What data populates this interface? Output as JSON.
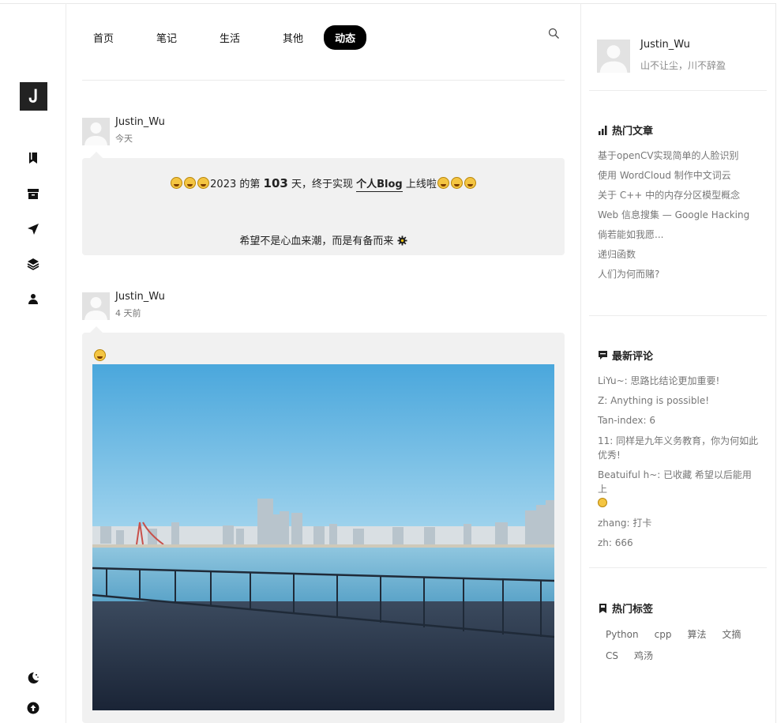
{
  "logo": {
    "glyph": "Ꭻ"
  },
  "rail": {
    "icons": [
      "bookmark-icon",
      "archive-icon",
      "send-icon",
      "layers-icon",
      "user-icon"
    ],
    "bottom_icons": [
      "dark-mode-icon",
      "back-to-top-icon"
    ]
  },
  "nav": {
    "items": [
      "首页",
      "笔记",
      "生活",
      "其他",
      "动态"
    ],
    "active": "动态"
  },
  "posts": [
    {
      "author": "Justin_Wu",
      "time": "今天",
      "line1_pre": "2023 的第 ",
      "line1_num": "103",
      "line1_mid": " 天，终于实现 ",
      "line1_link": "个人Blog",
      "line1_post": " 上线啦",
      "line2": "希望不是心血来潮，而是有备而来"
    },
    {
      "author": "Justin_Wu",
      "time": "4 天前"
    }
  ],
  "sidebar": {
    "name": "Justin_Wu",
    "motto": "山不让尘，川不辞盈",
    "hot_title": "热门文章",
    "hot": [
      "基于openCV实现简单的人脸识别",
      "使用 WordCloud 制作中文词云",
      "关于 C++ 中的内存分区模型概念",
      "Web 信息搜集 — Google Hacking",
      "倘若能如我愿...",
      "递归函数",
      "人们为何而赌?"
    ],
    "comments_title": "最新评论",
    "comments": [
      "LiYu~: 思路比结论更加重要!",
      "Z: Anything is possible!",
      "Tan-index: 6",
      "11: 同样是九年义务教育，你为何如此优秀!",
      "Beatuiful h~: 已收藏 希望以后能用上",
      "zhang: 打卡",
      "zh: 666"
    ],
    "tags_title": "热门标签",
    "tags": [
      "Python",
      "cpp",
      "算法",
      "文摘",
      "CS",
      "鸡汤"
    ]
  }
}
